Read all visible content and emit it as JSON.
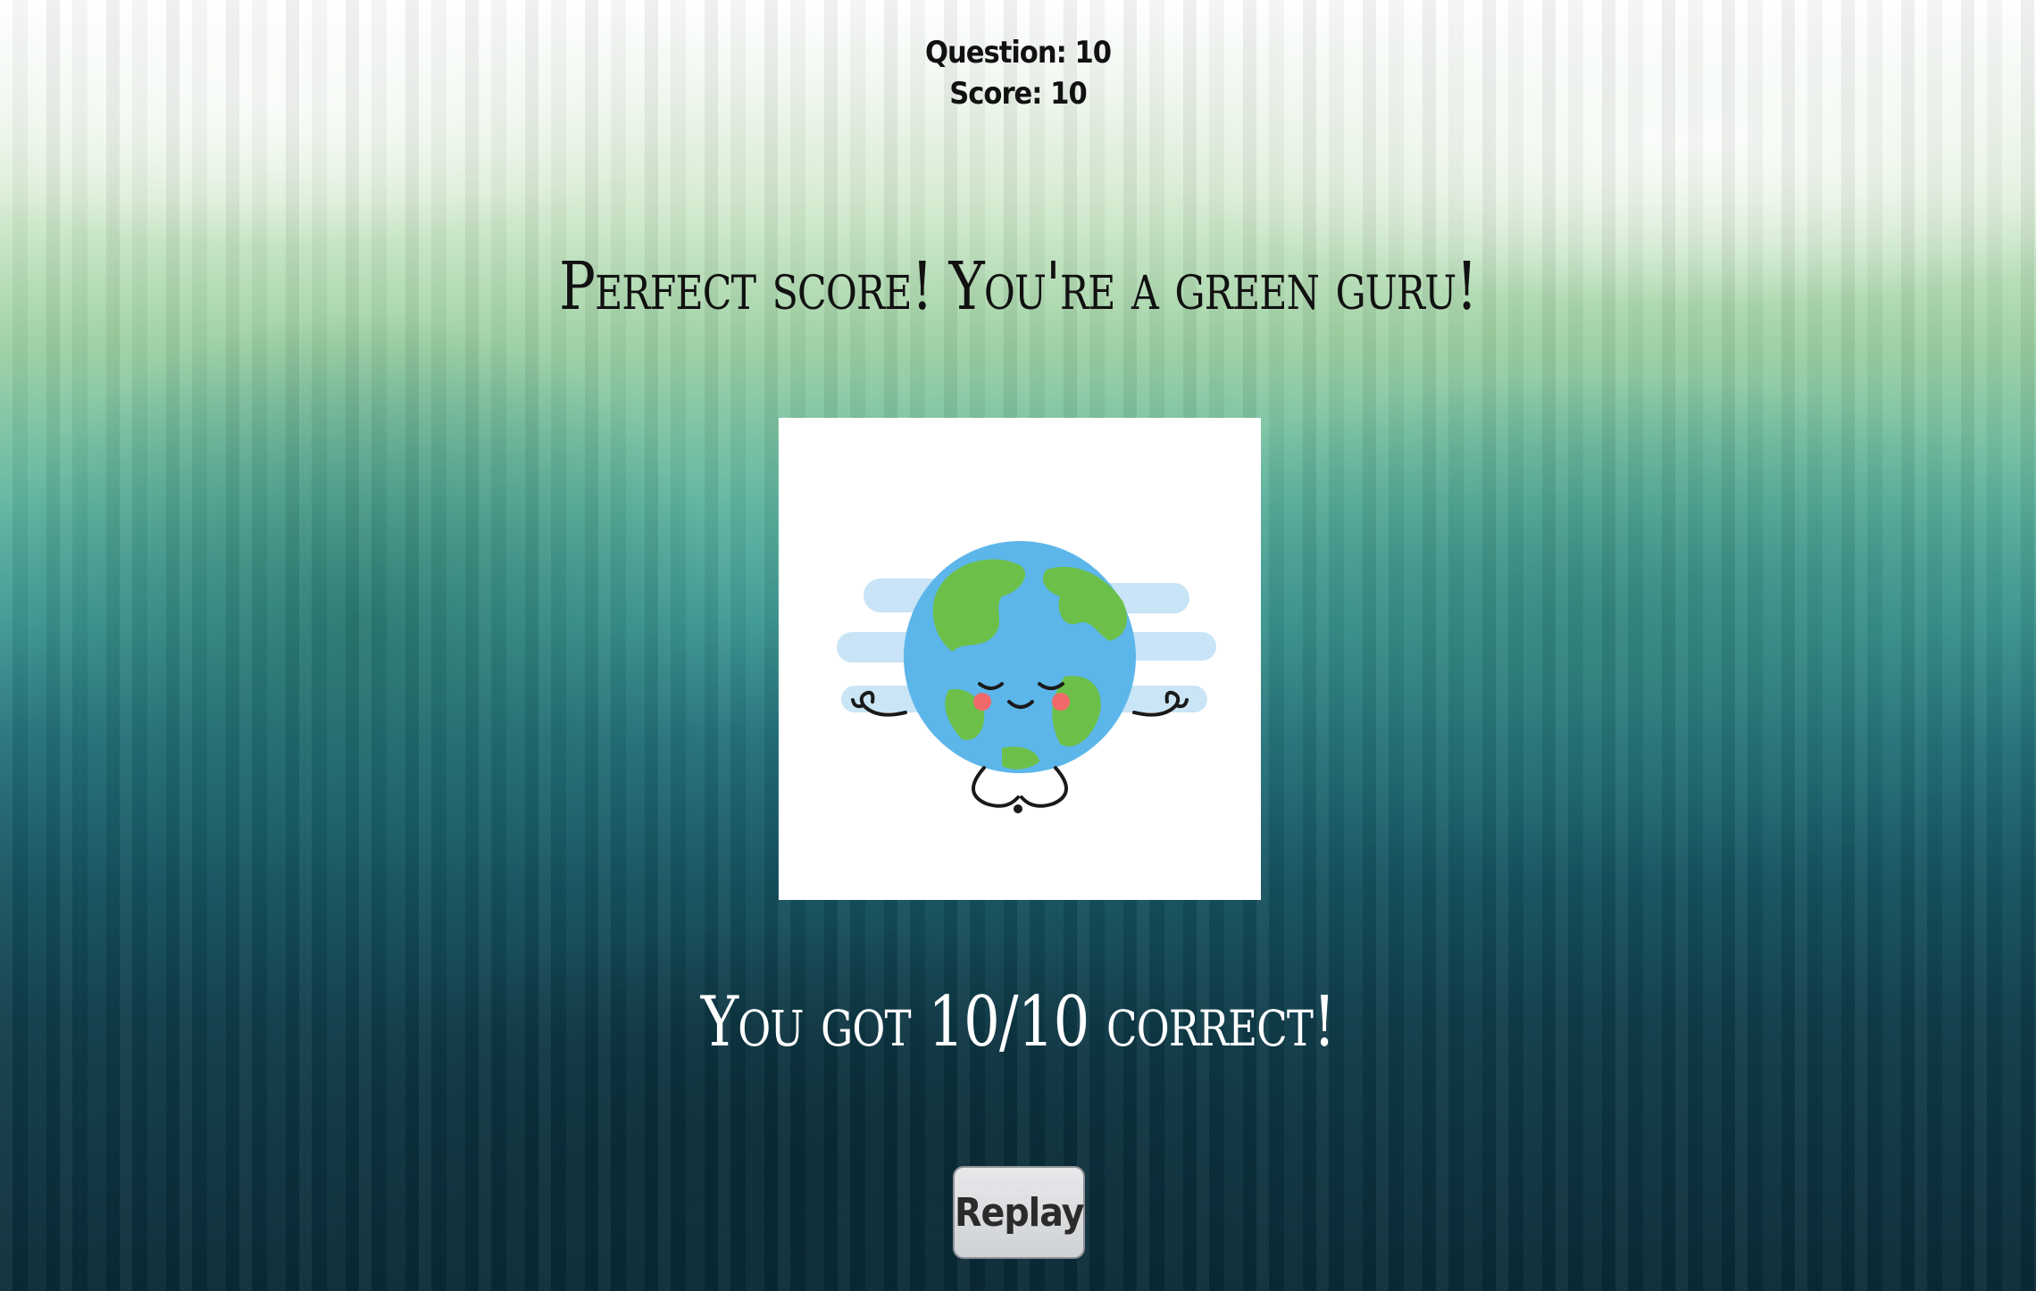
{
  "hud": {
    "question_label": "Question: 10",
    "score_label": "Score: 10"
  },
  "headline": "Perfect score! You're a green guru!",
  "result_text": "You got 10/10 correct!",
  "replay_label": "Replay",
  "illustration": {
    "icon": "meditating-earth-icon",
    "colors": {
      "ocean": "#5cb6ea",
      "land": "#6cc04a",
      "cheek": "#f06a6a",
      "cloud": "#bfe0f5"
    }
  }
}
